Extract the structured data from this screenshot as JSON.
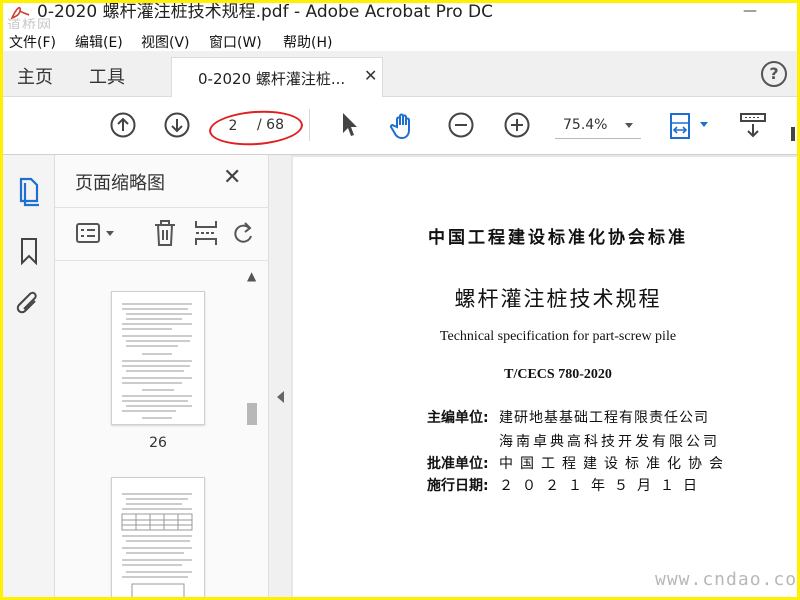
{
  "window": {
    "title": "0-2020 螺杆灌注桩技术规程.pdf - Adobe Acrobat Pro DC",
    "logo_text": "道桥网"
  },
  "menu": [
    "文件(F)",
    "编辑(E)",
    "视图(V)",
    "窗口(W)",
    "帮助(H)"
  ],
  "tabs": {
    "home": "主页",
    "tools": "工具",
    "doc": "0-2020 螺杆灌注桩...",
    "help": "?"
  },
  "toolbar": {
    "page_current": "2",
    "page_total": "/ 68",
    "zoom": "75.4%"
  },
  "panel": {
    "title": "页面缩略图",
    "thumbnails": [
      {
        "label": "26"
      },
      {
        "label": ""
      }
    ]
  },
  "document": {
    "standard_header": "中国工程建设标准化协会标准",
    "title": "螺杆灌注桩技术规程",
    "english_title": "Technical specification for part-screw pile",
    "code": "T/CECS 780-2020",
    "editor_label": "主编单位:",
    "editor_1": "建研地基基础工程有限责任公司",
    "editor_2": "海南卓典高科技开发有限公司",
    "approver_label": "批准单位:",
    "approver": "中国工程建设标准化协会",
    "date_label": "施行日期:",
    "date": "２０２１年５月１日"
  },
  "watermark": "www.cndao.com",
  "colors": {
    "accent_blue": "#1f6fd0",
    "highlight_red": "#e02020"
  }
}
